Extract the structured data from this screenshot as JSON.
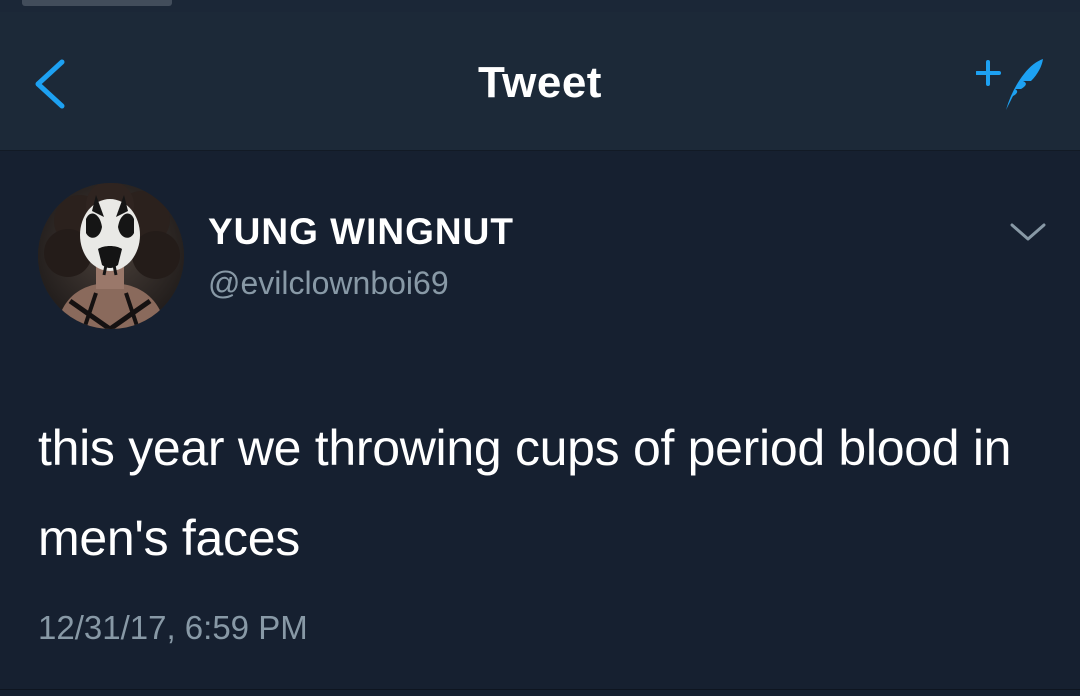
{
  "navbar": {
    "title": "Tweet",
    "back_icon": "chevron-left-icon",
    "compose_icon": "compose-tweet-icon"
  },
  "tweet": {
    "display_name": "YUNG WINGNUT",
    "handle": "@evilclownboi69",
    "text": "this year we throwing cups of period blood in men's faces",
    "timestamp": "12/31/17, 6:59 PM",
    "menu_icon": "chevron-down-icon"
  },
  "colors": {
    "background": "#162030",
    "navbar": "#1c2938",
    "accent": "#1da1f2",
    "secondary_text": "#8899a6"
  }
}
